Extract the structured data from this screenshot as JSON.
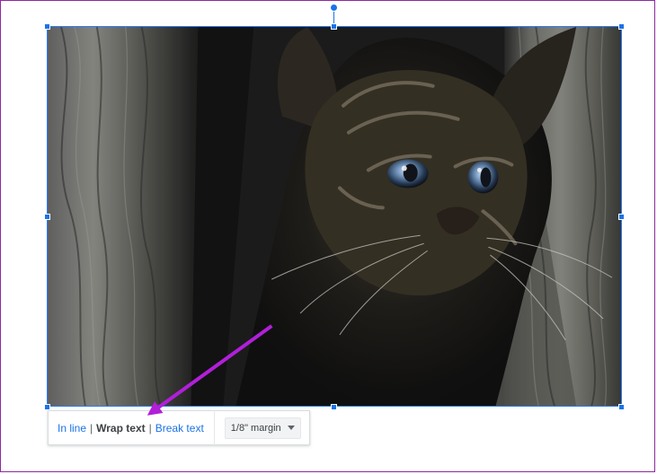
{
  "toolbar": {
    "in_line_label": "In line",
    "wrap_text_label": "Wrap text",
    "break_text_label": "Break text",
    "separator": "|",
    "margin_label": "1/8\" margin"
  },
  "image": {
    "selected": true
  },
  "colors": {
    "selection": "#1a73e8",
    "link": "#1a73e8",
    "text": "#3c4043",
    "annotation_arrow": "#b11fd9",
    "frame": "#8d2aa0"
  },
  "icons": {
    "rotate_handle": "rotate-handle-icon",
    "dropdown": "chevron-down-icon"
  }
}
